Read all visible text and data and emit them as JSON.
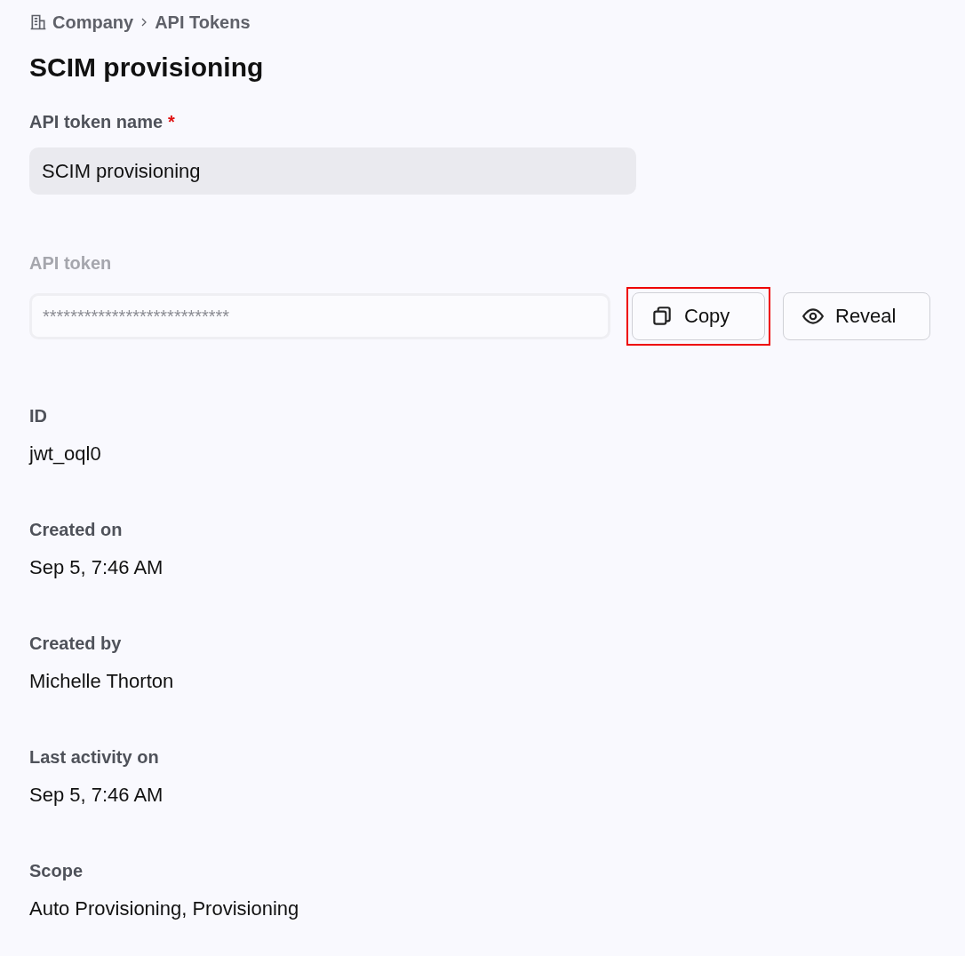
{
  "breadcrumb": [
    {
      "label": "Company",
      "kind": "building"
    },
    {
      "label": "API Tokens",
      "kind": "plain"
    }
  ],
  "title": "SCIM provisioning",
  "name_field": {
    "label": "API token name",
    "required": true,
    "required_mark": "*",
    "value": "SCIM provisioning"
  },
  "token_field": {
    "label": "API token",
    "disabled": true,
    "value": "***************************",
    "buttons": [
      {
        "label": "Copy",
        "kind": "copy",
        "highlighted": true
      },
      {
        "label": "Reveal",
        "kind": "reveal",
        "highlighted": false
      }
    ]
  },
  "details": [
    {
      "label": "ID",
      "value": "jwt_oql0"
    },
    {
      "label": "Created on",
      "value": "Sep 5, 7:46 AM"
    },
    {
      "label": "Created by",
      "value": "Michelle Thorton"
    },
    {
      "label": "Last activity on",
      "value": "Sep 5, 7:46 AM"
    },
    {
      "label": "Scope",
      "value": "Auto Provisioning, Provisioning"
    }
  ]
}
